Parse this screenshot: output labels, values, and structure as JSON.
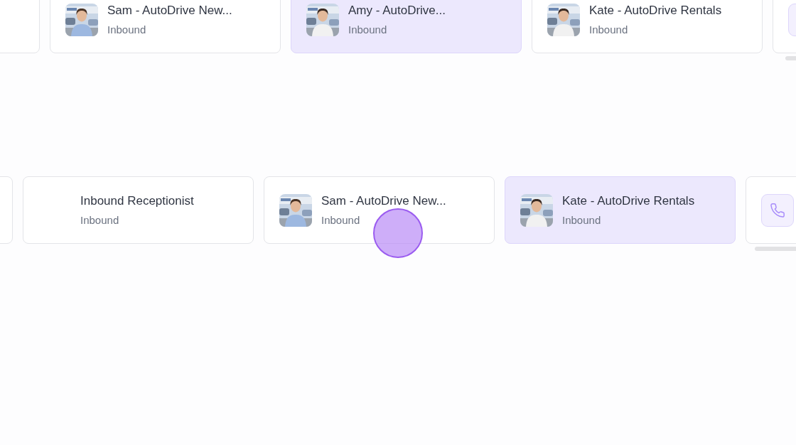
{
  "rows": [
    {
      "cards": [
        {
          "kind": "empty",
          "selected": false
        },
        {
          "kind": "avatar",
          "title": "Sam - AutoDrive New...",
          "subtitle": "Inbound",
          "selected": false
        },
        {
          "kind": "avatar",
          "title": "Amy - AutoDrive...",
          "subtitle": "Inbound",
          "selected": true
        },
        {
          "kind": "avatar",
          "title": "Kate - AutoDrive Rentals",
          "subtitle": "Inbound",
          "selected": false
        },
        {
          "kind": "tile",
          "selected": false
        }
      ]
    },
    {
      "cards": [
        {
          "kind": "empty",
          "selected": false
        },
        {
          "kind": "blank",
          "title": "Inbound Receptionist",
          "subtitle": "Inbound",
          "selected": false
        },
        {
          "kind": "avatar",
          "title": "Sam - AutoDrive New...",
          "subtitle": "Inbound",
          "selected": false
        },
        {
          "kind": "avatar",
          "title": "Kate - AutoDrive Rentals",
          "subtitle": "Inbound",
          "selected": true
        },
        {
          "kind": "phone",
          "selected": false
        }
      ]
    }
  ]
}
